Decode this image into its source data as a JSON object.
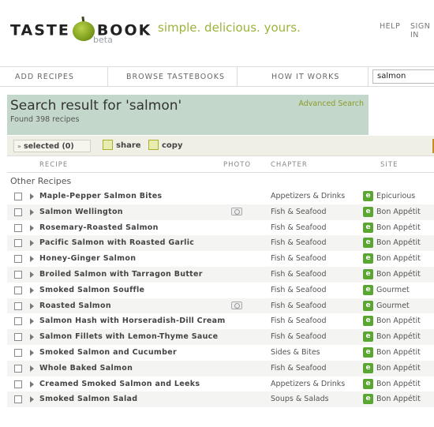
{
  "header": {
    "logo_left": "TASTE",
    "logo_right": "BOOK",
    "beta": "beta",
    "tagline": "simple. delicious. yours.",
    "help": "HELP",
    "signin": "SIGN IN"
  },
  "nav": {
    "items": [
      "ADD RECIPES",
      "BROWSE TASTEBOOKS",
      "HOW IT WORKS"
    ],
    "search_value": "salmon"
  },
  "results": {
    "title": "Search result for 'salmon'",
    "count": "Found 398 recipes",
    "advanced": "Advanced Search"
  },
  "toolbar": {
    "selected": "selected (0)",
    "share": "share",
    "copy": "copy"
  },
  "table": {
    "columns": {
      "recipe": "RECIPE",
      "photo": "PHOTO",
      "chapter": "CHAPTER",
      "site": "SITE"
    },
    "group": "Other Recipes",
    "rows": [
      {
        "name": "Maple-Pepper Salmon Bites",
        "photo": false,
        "chapter": "Appetizers & Drinks",
        "site": "Epicurious"
      },
      {
        "name": "Salmon Wellington",
        "photo": true,
        "chapter": "Fish & Seafood",
        "site": "Bon Appétit"
      },
      {
        "name": "Rosemary-Roasted Salmon",
        "photo": false,
        "chapter": "Fish & Seafood",
        "site": "Bon Appétit"
      },
      {
        "name": "Pacific Salmon with Roasted Garlic",
        "photo": false,
        "chapter": "Fish & Seafood",
        "site": "Bon Appétit"
      },
      {
        "name": "Honey-Ginger Salmon",
        "photo": false,
        "chapter": "Fish & Seafood",
        "site": "Bon Appétit"
      },
      {
        "name": "Broiled Salmon with Tarragon Butter",
        "photo": false,
        "chapter": "Fish & Seafood",
        "site": "Bon Appétit"
      },
      {
        "name": "Smoked Salmon Souffle",
        "photo": false,
        "chapter": "Fish & Seafood",
        "site": "Gourmet"
      },
      {
        "name": "Roasted Salmon",
        "photo": true,
        "chapter": "Fish & Seafood",
        "site": "Gourmet"
      },
      {
        "name": "Salmon Hash with Horseradish-Dill Cream",
        "photo": false,
        "chapter": "Fish & Seafood",
        "site": "Bon Appétit"
      },
      {
        "name": "Salmon Fillets with Lemon-Thyme Sauce",
        "photo": false,
        "chapter": "Fish & Seafood",
        "site": "Bon Appétit"
      },
      {
        "name": "Smoked Salmon and Cucumber",
        "photo": false,
        "chapter": "Sides & Bites",
        "site": "Bon Appétit"
      },
      {
        "name": "Whole Baked Salmon",
        "photo": false,
        "chapter": "Fish & Seafood",
        "site": "Bon Appétit"
      },
      {
        "name": "Creamed Smoked Salmon and Leeks",
        "photo": false,
        "chapter": "Appetizers & Drinks",
        "site": "Bon Appétit"
      },
      {
        "name": "Smoked Salmon Salad",
        "photo": false,
        "chapter": "Soups & Salads",
        "site": "Bon Appétit"
      }
    ]
  }
}
